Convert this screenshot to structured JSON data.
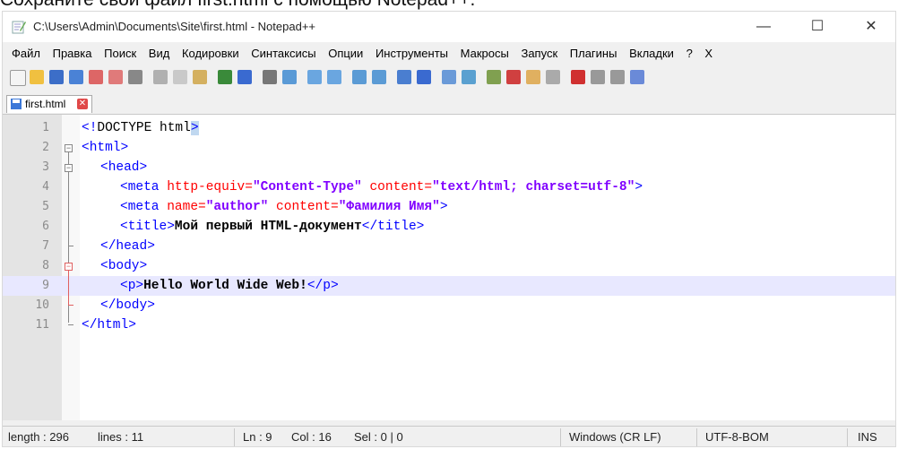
{
  "caption": "Сохраните свой файл first.html с помощью Notepad++.",
  "window": {
    "title": "C:\\Users\\Admin\\Documents\\Site\\first.html - Notepad++",
    "minimize": "—",
    "maximize": "☐",
    "close": "✕"
  },
  "menu": [
    "Файл",
    "Правка",
    "Поиск",
    "Вид",
    "Кодировки",
    "Синтаксисы",
    "Опции",
    "Инструменты",
    "Макросы",
    "Запуск",
    "Плагины",
    "Вкладки",
    "?",
    "X"
  ],
  "tab": {
    "label": "first.html",
    "close": "✕"
  },
  "lines": [
    "1",
    "2",
    "3",
    "4",
    "5",
    "6",
    "7",
    "8",
    "9",
    "10",
    "11"
  ],
  "code": {
    "l1_open": "<!",
    "l1_doc": "DOCTYPE html",
    "l1_close": ">",
    "l2": "<html>",
    "l3": "<head>",
    "l4_a": "<meta ",
    "l4_b": "http-equiv=",
    "l4_c": "\"Content-Type\"",
    "l4_d": " content=",
    "l4_e": "\"text/html; charset=utf-8\"",
    "l4_f": ">",
    "l5_a": "<meta ",
    "l5_b": "name=",
    "l5_c": "\"author\"",
    "l5_d": " content=",
    "l5_e": "\"Фамилия Имя\"",
    "l5_f": ">",
    "l6_a": "<title>",
    "l6_b": "Мой первый HTML-документ",
    "l6_c": "</title>",
    "l7": "</head>",
    "l8": "<body>",
    "l9_a": "<p>",
    "l9_b": "Hello World Wide Web!",
    "l9_c": "</p>",
    "l10": "</body>",
    "l11": "</html>"
  },
  "status": {
    "length": "length : 296",
    "lines": "lines : 11",
    "ln": "Ln : 9",
    "col": "Col : 16",
    "sel": "Sel : 0 | 0",
    "eol": "Windows (CR LF)",
    "encoding": "UTF-8-BOM",
    "mode": "INS"
  },
  "colors": {
    "tag": "#0000ff",
    "attr": "#ff0000",
    "string": "#8000ff",
    "current_line": "#e8e8ff"
  }
}
